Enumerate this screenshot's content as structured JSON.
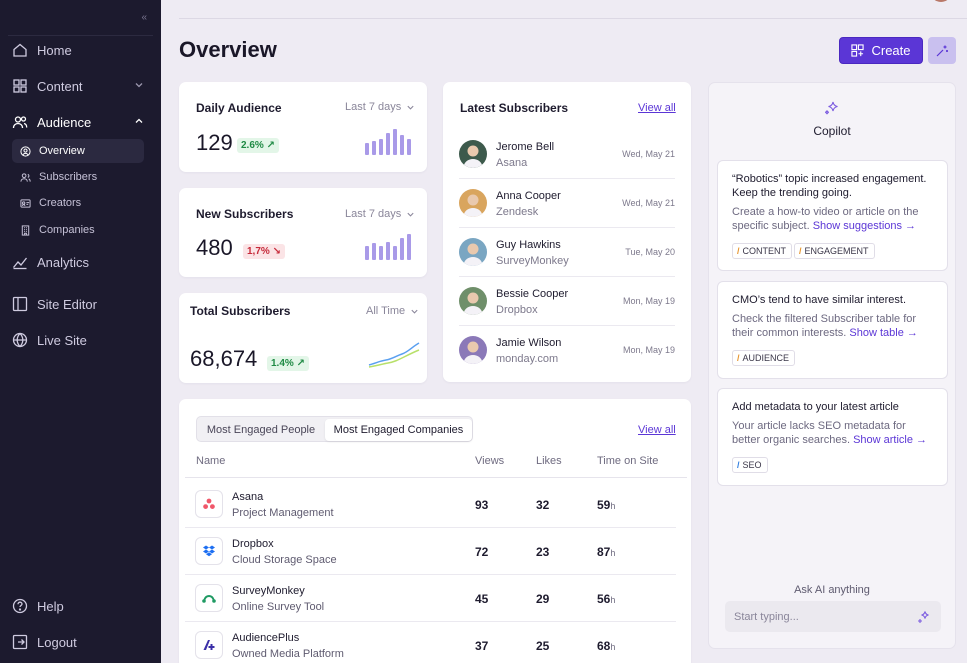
{
  "sidebar": {
    "collapse_icon": "chevrons-left-icon",
    "nav": [
      {
        "label": "Home",
        "icon": "home-icon"
      },
      {
        "label": "Content",
        "icon": "grid-icon"
      },
      {
        "label": "Audience",
        "icon": "users-icon"
      },
      {
        "label": "Analytics",
        "icon": "analytics-icon"
      },
      {
        "label": "Site Editor",
        "icon": "layout-icon"
      },
      {
        "label": "Live Site",
        "icon": "globe-icon"
      }
    ],
    "audience_sub": [
      {
        "label": "Overview",
        "icon": "user-circle-icon"
      },
      {
        "label": "Subscribers",
        "icon": "subscribers-icon"
      },
      {
        "label": "Creators",
        "icon": "id-card-icon"
      },
      {
        "label": "Companies",
        "icon": "building-icon"
      }
    ],
    "bottom": [
      {
        "label": "Help",
        "icon": "help-icon"
      },
      {
        "label": "Logout",
        "icon": "logout-icon"
      }
    ]
  },
  "header": {
    "title": "Overview",
    "create_label": "Create"
  },
  "daily": {
    "title": "Daily Audience",
    "range": "Last 7 days",
    "value": "129",
    "change": "2.6% ↗",
    "trend": "up",
    "bars": [
      0.45,
      0.55,
      0.6,
      0.85,
      1.0,
      0.75,
      0.6
    ]
  },
  "new_subs": {
    "title": "New Subscribers",
    "range": "Last 7 days",
    "value": "480",
    "change": "1,7% ↘",
    "trend": "down",
    "bars": [
      0.55,
      0.65,
      0.55,
      0.7,
      0.55,
      0.85,
      1.0
    ]
  },
  "total_subs": {
    "title": "Total Subscribers",
    "range": "All Time",
    "value": "68,674",
    "change": "1.4% ↗",
    "trend": "up"
  },
  "latest": {
    "title": "Latest Subscribers",
    "view_all": "View all",
    "rows": [
      {
        "name": "Jerome Bell",
        "company": "Asana",
        "date": "Wed, May 21",
        "color": "#3d5a4c"
      },
      {
        "name": "Anna Cooper",
        "company": "Zendesk",
        "date": "Wed, May 21",
        "color": "#d9a55e"
      },
      {
        "name": "Guy Hawkins",
        "company": "SurveyMonkey",
        "date": "Tue, May 20",
        "color": "#7aa6c2"
      },
      {
        "name": "Bessie Cooper",
        "company": "Dropbox",
        "date": "Mon, May 19",
        "color": "#6f8f6a"
      },
      {
        "name": "Jamie Wilson",
        "company": "monday.com",
        "date": "Mon, May 19",
        "color": "#8b79b8"
      }
    ]
  },
  "engaged": {
    "tabs": [
      "Most Engaged People",
      "Most Engaged Companies"
    ],
    "active_tab": 1,
    "view_all": "View all",
    "columns": [
      "Name",
      "Views",
      "Likes",
      "Time on Site"
    ],
    "time_unit": "h",
    "rows": [
      {
        "name": "Asana",
        "desc": "Project Management",
        "views": "93",
        "likes": "32",
        "time": "59",
        "logo": "asana-logo-icon"
      },
      {
        "name": "Dropbox",
        "desc": "Cloud Storage Space",
        "views": "72",
        "likes": "23",
        "time": "87",
        "logo": "dropbox-logo-icon"
      },
      {
        "name": "SurveyMonkey",
        "desc": "Online Survey Tool",
        "views": "45",
        "likes": "29",
        "time": "56",
        "logo": "surveymonkey-logo-icon"
      },
      {
        "name": "AudiencePlus",
        "desc": "Owned Media Platform",
        "views": "37",
        "likes": "25",
        "time": "68",
        "logo": "audienceplus-logo-icon"
      }
    ]
  },
  "copilot": {
    "title": "Copilot",
    "insights": [
      {
        "title": "“Robotics” topic increased engagement. Keep the trending going.",
        "body": "Create a how-to video or article on the specific subject.",
        "action": "Show suggestions →",
        "tags": [
          "CONTENT",
          "ENGAGEMENT"
        ]
      },
      {
        "title": "CMO’s tend to have similar interest.",
        "body": "Check the filtered Subscriber table for their common interests.",
        "action": "Show table →",
        "tags": [
          "AUDIENCE"
        ]
      },
      {
        "title": "Add metadata to your latest article",
        "body": "Your article lacks SEO metadata for better organic searches.",
        "action": "Show article →",
        "tags": [
          "SEO"
        ]
      }
    ],
    "ask_label": "Ask AI anything",
    "input_placeholder": "Start typing..."
  },
  "colors": {
    "sidebar_bg": "#1c1a2e",
    "accent": "#5b36d6",
    "bar": "#a99ae8",
    "positive": "#1f8a44",
    "negative": "#c62a3a"
  }
}
